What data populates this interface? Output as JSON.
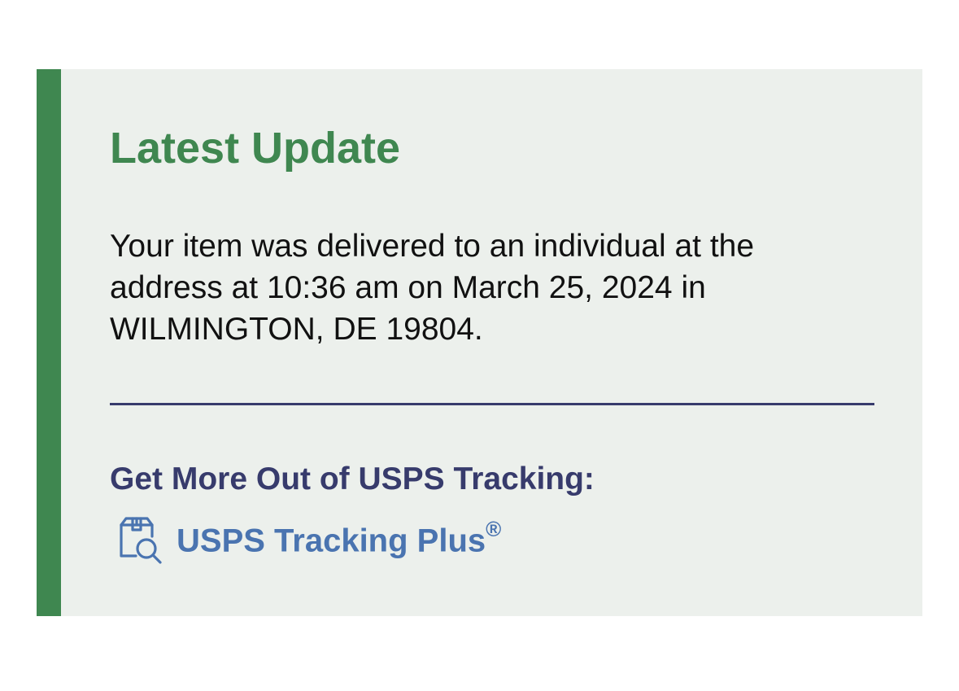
{
  "latest_update": {
    "title": "Latest Update",
    "message": "Your item was delivered to an individual at the address at 10:36 am on March 25, 2024 in WILMINGTON, DE 19804."
  },
  "more_section": {
    "heading": "Get More Out of USPS Tracking:",
    "link": {
      "icon": "package-search-icon",
      "label": "USPS Tracking Plus",
      "trademark": "®"
    }
  },
  "colors": {
    "accent_green": "#3f8750",
    "card_background": "#ecf0ec",
    "navy": "#373b6c",
    "link_blue": "#4a74b0"
  }
}
